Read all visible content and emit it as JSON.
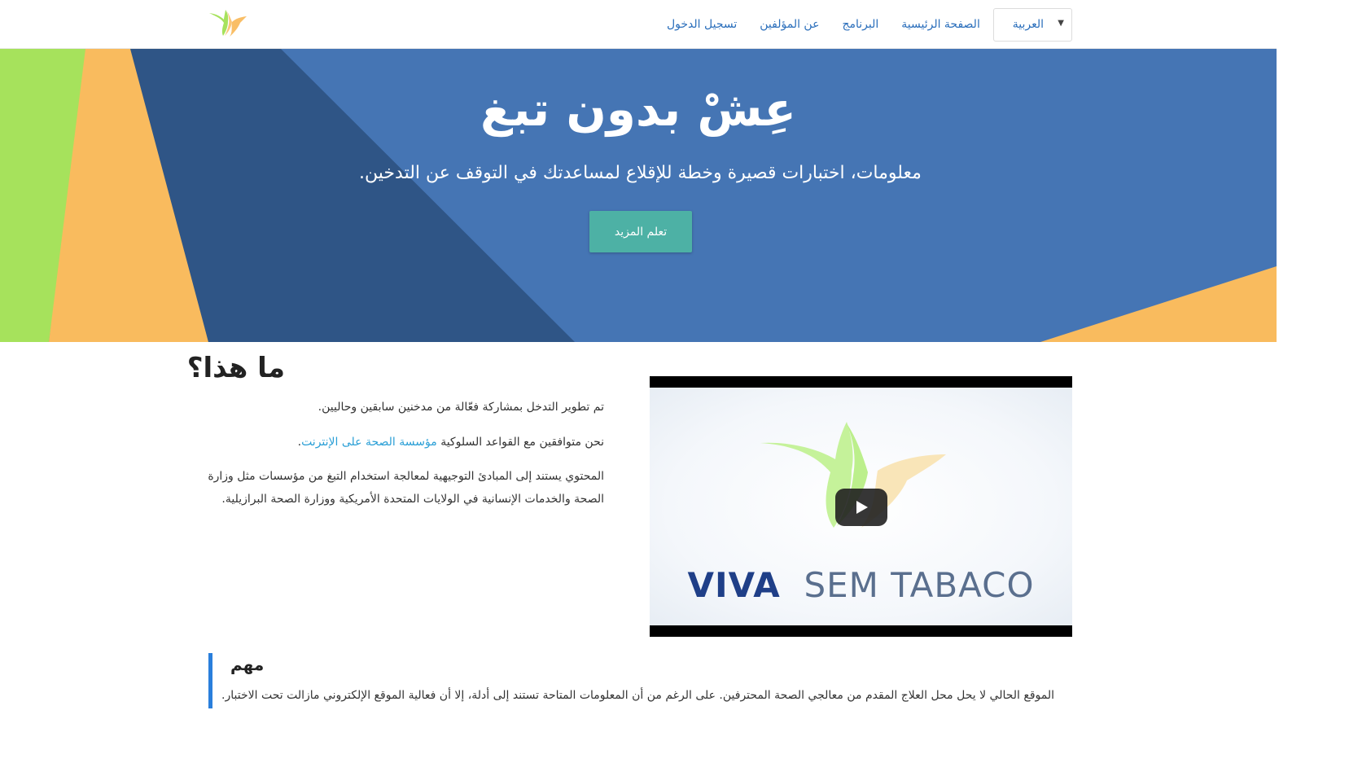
{
  "nav": {
    "links": [
      "الصفحة الرئيسية",
      "البرنامج",
      "عن المؤلفين",
      "تسجيل الدخول"
    ],
    "language": {
      "selected": "العربية"
    }
  },
  "hero": {
    "title": "عِشْ بدون تبغ",
    "subtitle": "معلومات، اختبارات قصيرة وخطة للإقلاع لمساعدتك في التوقف عن التدخين.",
    "button_label": "تعلم المزيد"
  },
  "about": {
    "title": "ما هذا؟",
    "p1": "تم تطوير التدخل بمشاركة فعّالة من مدخنين سابقين وحاليين.",
    "p2_prefix": "نحن متوافقين مع القواعد السلوكية",
    "p2_link": "مؤسسة الصحة على الإنترنت",
    "p2_suffix": ".",
    "p3": "المحتوي يستند إلى المبادئ التوجيهية لمعالجة استخدام التبغ من مؤسسات مثل وزارة الصحة والخدمات الإنسانية في الولايات المتحدة الأمريكية ووزارة الصحة البرازيلية."
  },
  "video": {
    "brand_word1": "VIVA",
    "brand_word2": "SEM TABACO"
  },
  "notice": {
    "title": "مهم",
    "text": "الموقع الحالي لا يحل محل العلاج المقدم من معالجي الصحة المحترفين. على الرغم من أن المعلومات المتاحة تستند إلى أدلة، إلا أن فعالية الموقع الإلكتروني مازالت تحت الاختبار."
  },
  "colors": {
    "hero_blue": "#4575b4",
    "hero_dark_blue": "#2f5586",
    "green": "#a6e25c",
    "orange": "#f9bb5e",
    "button_teal": "#4db1a5",
    "link_blue": "#2a6ebb"
  },
  "icons": {
    "logo": "bird-logo-icon",
    "dropdown": "caret-down-icon",
    "play": "play-icon"
  }
}
